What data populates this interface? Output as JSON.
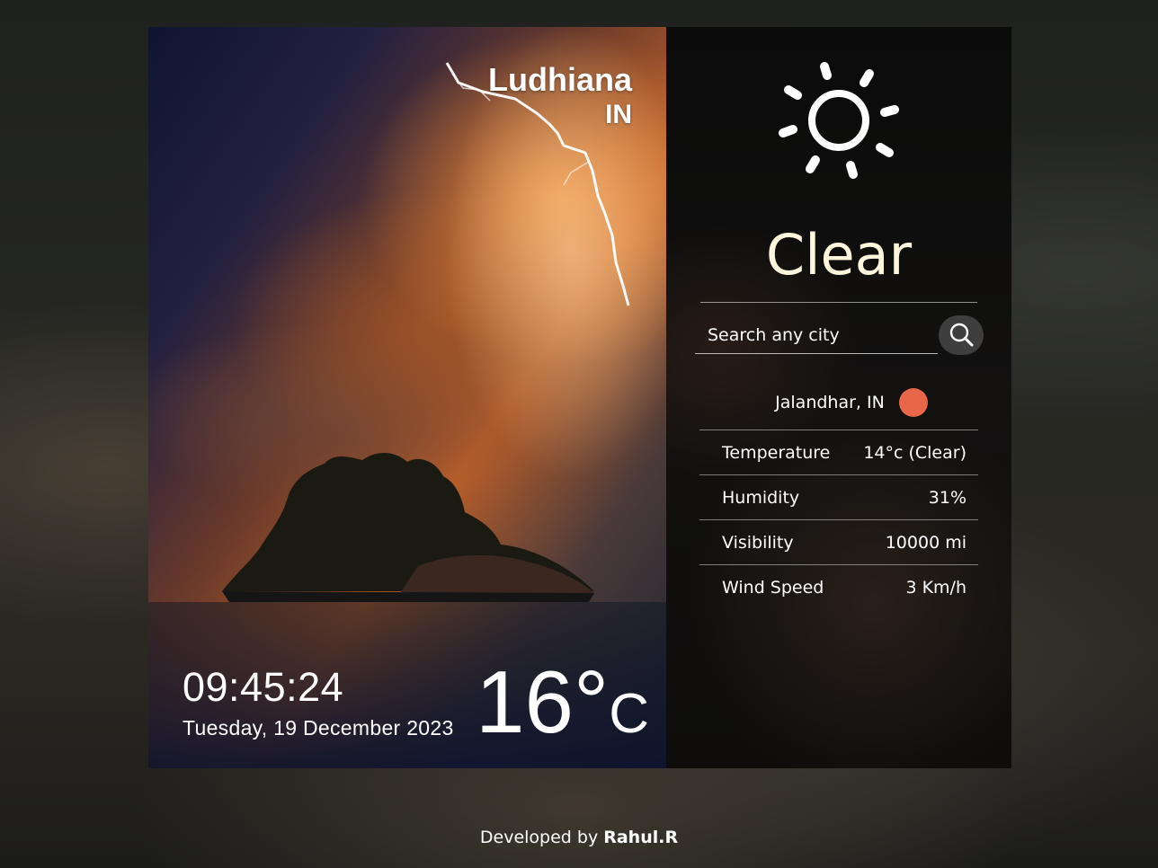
{
  "location": {
    "city": "Ludhiana",
    "country": "IN"
  },
  "clock": {
    "time": "09:45:24",
    "date": "Tuesday, 19 December 2023"
  },
  "current": {
    "temperature": "16°",
    "unit": "C"
  },
  "weather": {
    "status": "Clear",
    "icon": "sun-icon"
  },
  "search": {
    "placeholder": "Search any city",
    "button_icon": "search-icon"
  },
  "result": {
    "location": "Jalandhar, IN",
    "status_color": "#e8664a",
    "stats": [
      {
        "label": "Temperature",
        "value": "14°c (Clear)"
      },
      {
        "label": "Humidity",
        "value": "31%"
      },
      {
        "label": "Visibility",
        "value": "10000 mi"
      },
      {
        "label": "Wind Speed",
        "value": "3 Km/h"
      }
    ]
  },
  "footer": {
    "prefix": "Developed by",
    "author": "Rahul.R"
  }
}
